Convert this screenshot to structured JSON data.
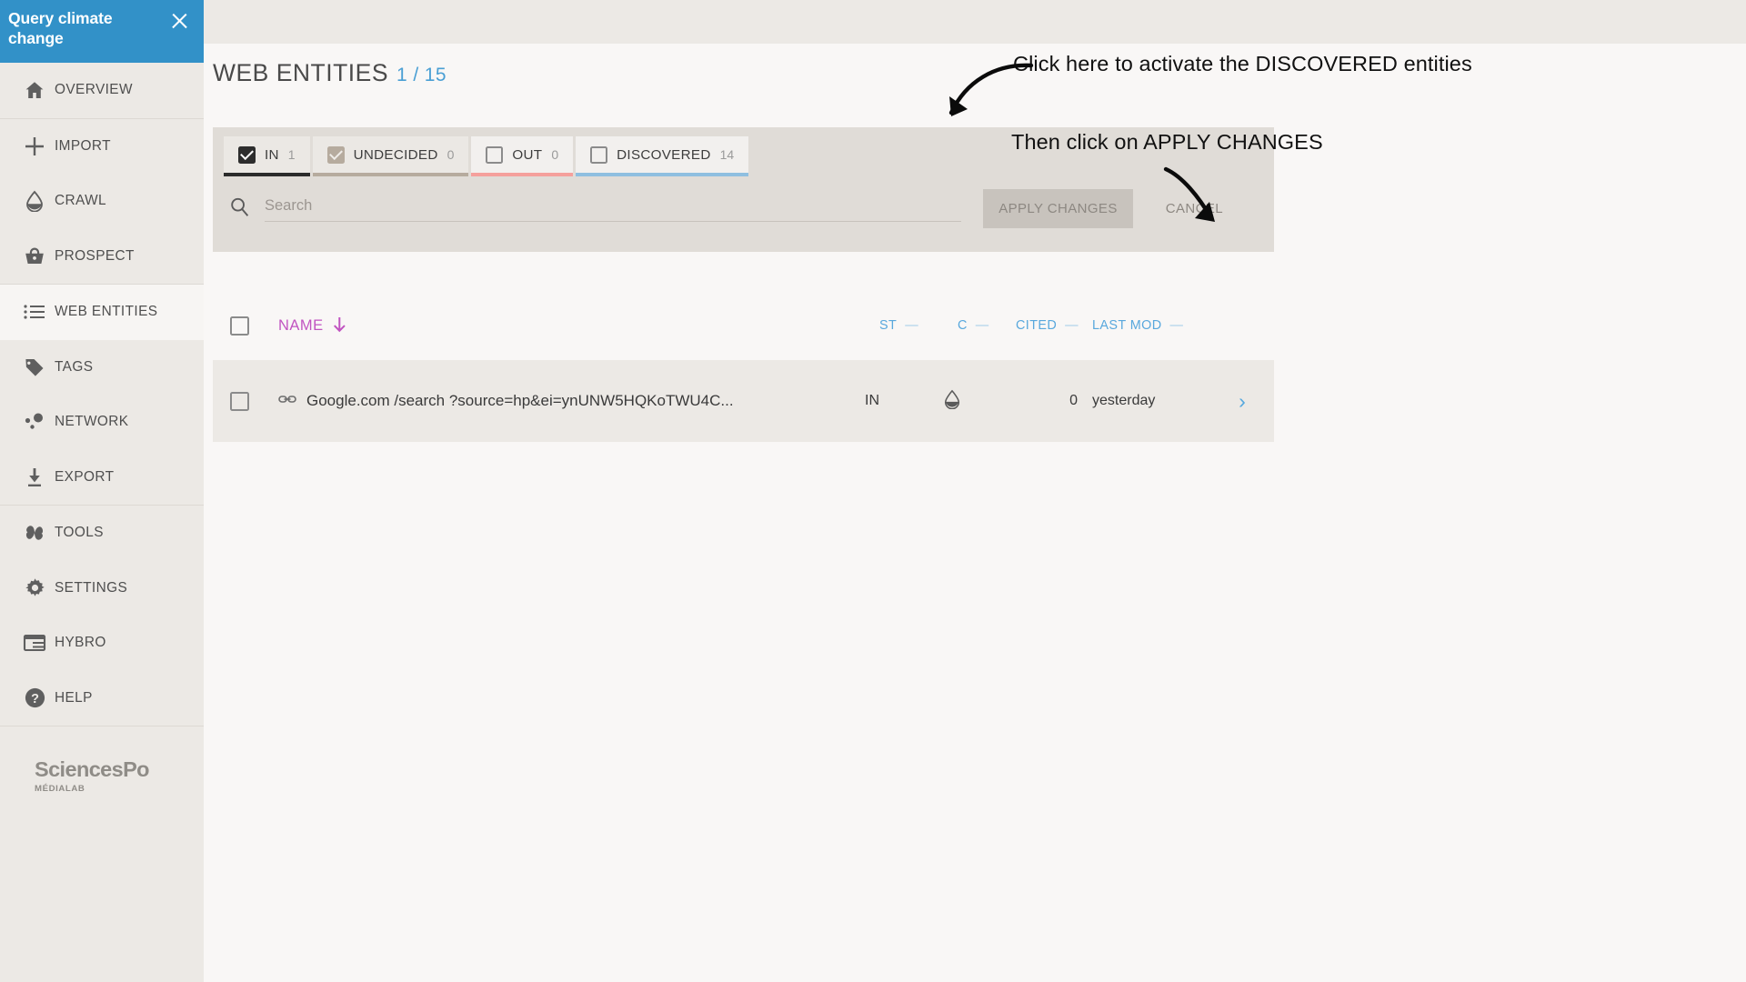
{
  "sidebar": {
    "project_title": "Query climate change",
    "close_icon": "close-icon",
    "groups": [
      {
        "items": [
          {
            "label": "OVERVIEW",
            "icon": "home-icon",
            "active": false
          }
        ]
      },
      {
        "items": [
          {
            "label": "IMPORT",
            "icon": "plus-icon",
            "active": false
          },
          {
            "label": "CRAWL",
            "icon": "droplet-icon",
            "active": false
          },
          {
            "label": "PROSPECT",
            "icon": "basket-icon",
            "active": false
          }
        ]
      },
      {
        "items": [
          {
            "label": "WEB ENTITIES",
            "icon": "list-icon",
            "active": true
          },
          {
            "label": "TAGS",
            "icon": "tag-icon",
            "active": false
          },
          {
            "label": "NETWORK",
            "icon": "network-icon",
            "active": false
          },
          {
            "label": "EXPORT",
            "icon": "download-icon",
            "active": false
          }
        ]
      },
      {
        "items": [
          {
            "label": "TOOLS",
            "icon": "pinwheel-icon",
            "active": false
          },
          {
            "label": "SETTINGS",
            "icon": "gear-icon",
            "active": false
          },
          {
            "label": "HYBRO",
            "icon": "layout-icon",
            "active": false
          },
          {
            "label": "HELP",
            "icon": "question-icon",
            "active": false
          }
        ]
      }
    ],
    "logo": {
      "main": "SciencesPo",
      "sub": "MÉDIALAB"
    }
  },
  "header": {
    "title": "WEB ENTITIES",
    "count": "1 / 15"
  },
  "filters": {
    "tabs": [
      {
        "label": "IN",
        "count": "1",
        "state": "checked-dark",
        "underline": "u-dark",
        "bg": "ebe8e4"
      },
      {
        "label": "UNDECIDED",
        "count": "0",
        "state": "checked-tan",
        "underline": "u-tan",
        "bg": "ebe8e4"
      },
      {
        "label": "OUT",
        "count": "0",
        "state": "empty",
        "underline": "u-pink",
        "bg": "f2f0ee"
      },
      {
        "label": "DISCOVERED",
        "count": "14",
        "state": "empty",
        "underline": "u-blue",
        "bg": "f2f0ee"
      }
    ],
    "search": {
      "value": "",
      "placeholder": "Search",
      "icon": "search-icon"
    },
    "apply_label": "APPLY CHANGES",
    "cancel_label": "CANCEL"
  },
  "table": {
    "columns": {
      "name": "NAME",
      "st": "ST",
      "c": "C",
      "cited": "CITED",
      "last_mod": "LAST MOD",
      "sort_dir": "desc",
      "dash": "—"
    },
    "rows": [
      {
        "name": "Google.com /search ?source=hp&ei=ynUNW5HQKoTWU4C...",
        "status": "IN",
        "crawl_icon": "droplet-icon",
        "cited": "0",
        "last_mod": "yesterday",
        "chevron": "›"
      }
    ]
  },
  "annotations": [
    {
      "text": "Click here to activate the DISCOVERED entities"
    },
    {
      "text": "Then click on APPLY CHANGES"
    }
  ],
  "colors": {
    "brand_blue": "#3291c8",
    "accent_blue": "#4a9fd4",
    "name_magenta": "#c154c1",
    "tab_in": "#2b2b2b",
    "tab_undecided": "#b6ab9e",
    "tab_out": "#f5a09c",
    "tab_discovered": "#8fbfe0",
    "sidebar_bg": "#ece9e5"
  }
}
